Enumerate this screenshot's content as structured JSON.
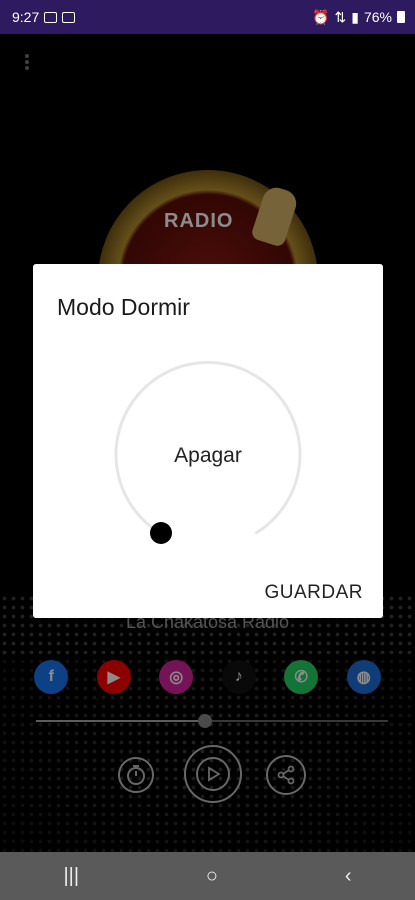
{
  "status_bar": {
    "time": "9:27",
    "battery": "76%"
  },
  "logo": {
    "text": "RADIO"
  },
  "station": {
    "name": "La Chakatosa Radio"
  },
  "social": [
    {
      "name": "facebook",
      "glyph": "f",
      "color": "#1877f2"
    },
    {
      "name": "youtube",
      "glyph": "▶",
      "color": "#ff0000"
    },
    {
      "name": "instagram",
      "glyph": "◎",
      "color": "#d6249f"
    },
    {
      "name": "tiktok",
      "glyph": "♪",
      "color": "#ffffff"
    },
    {
      "name": "whatsapp",
      "glyph": "✆",
      "color": "#25d366"
    },
    {
      "name": "website",
      "glyph": "◍",
      "color": "#1e6fd9"
    }
  ],
  "playback": {
    "progress": 0.48
  },
  "dialog": {
    "title": "Modo Dormir",
    "dial_value_label": "Apagar",
    "save_label": "GUARDAR"
  }
}
